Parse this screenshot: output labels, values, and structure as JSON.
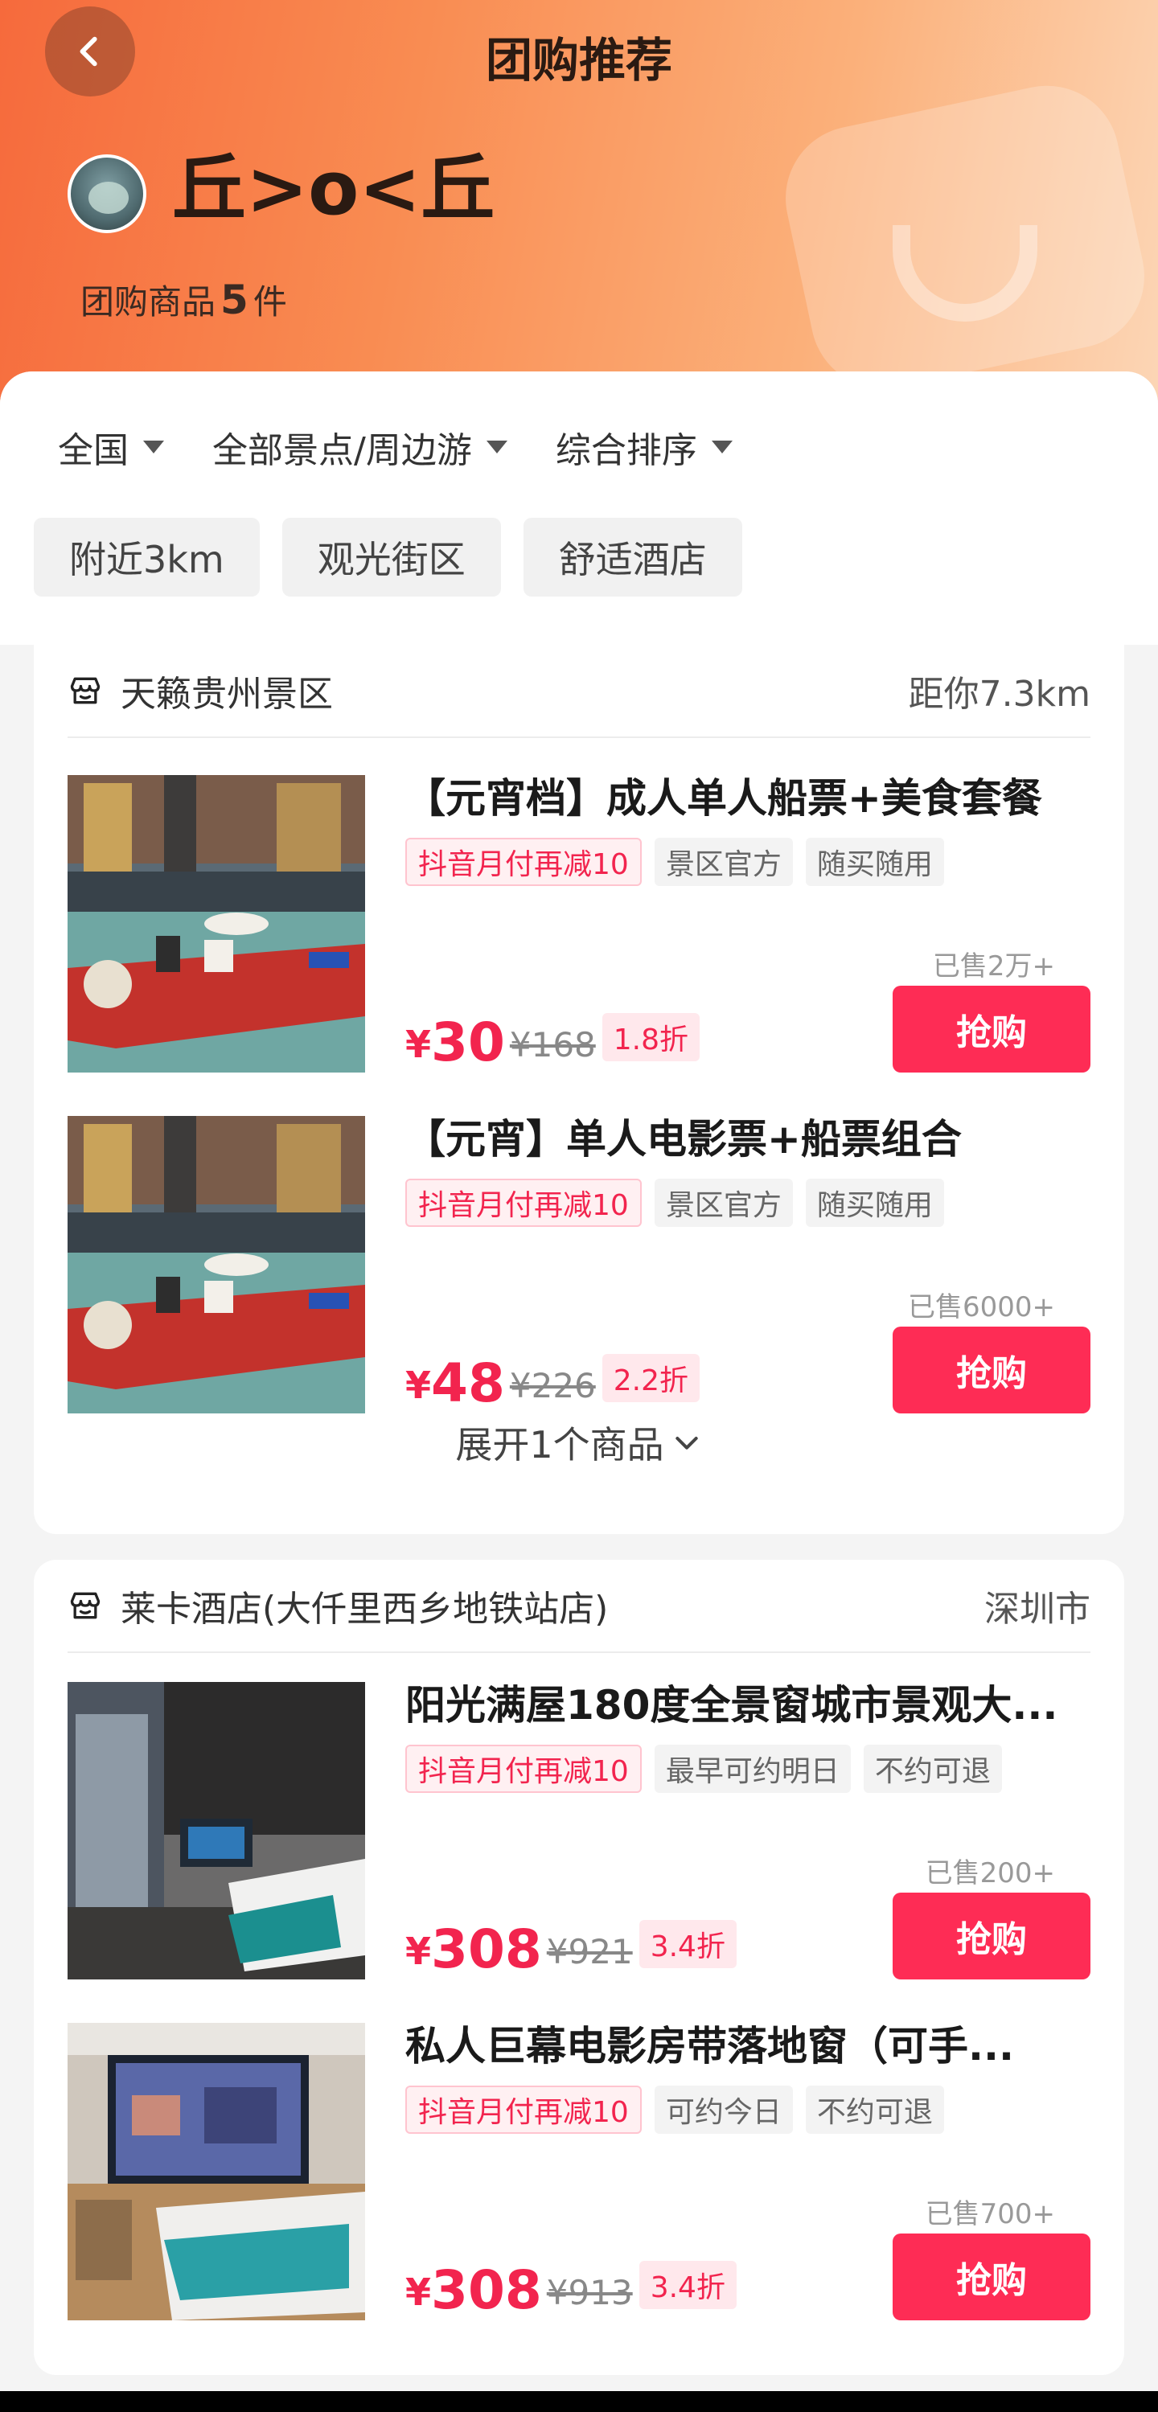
{
  "nav": {
    "title": "团购推荐",
    "back_icon": "chevron-left-icon"
  },
  "shop": {
    "name": "丘>o<丘",
    "count_label": "团购商品",
    "count": "5",
    "count_unit": "件"
  },
  "filters": [
    {
      "label": "全国"
    },
    {
      "label": "全部景点/周边游"
    },
    {
      "label": "综合排序"
    }
  ],
  "chips": [
    "附近3km",
    "观光街区",
    "舒适酒店"
  ],
  "stores": [
    {
      "name": "天籁贵州景区",
      "distance": "距你7.3km",
      "items": [
        {
          "title": "【元宵档】成人单人船票+美食套餐",
          "tags": [
            "抖音月付再减10",
            "景区官方",
            "随买随用"
          ],
          "sold": "已售2万+",
          "yen": "¥",
          "price": "30",
          "original": "¥168",
          "discount": "1.8折",
          "button": "抢购"
        },
        {
          "title": "【元宵】单人电影票+船票组合",
          "tags": [
            "抖音月付再减10",
            "景区官方",
            "随买随用"
          ],
          "sold": "已售6000+",
          "yen": "¥",
          "price": "48",
          "original": "¥226",
          "discount": "2.2折",
          "button": "抢购"
        }
      ],
      "expand": "展开1个商品"
    },
    {
      "name": "莱卡酒店(大仟里西乡地铁站店)",
      "distance": "深圳市",
      "items": [
        {
          "title": "阳光满屋180度全景窗城市景观大...",
          "tags": [
            "抖音月付再减10",
            "最早可约明日",
            "不约可退"
          ],
          "sold": "已售200+",
          "yen": "¥",
          "price": "308",
          "original": "¥921",
          "discount": "3.4折",
          "button": "抢购"
        },
        {
          "title": "私人巨幕电影房带落地窗（可手...",
          "tags": [
            "抖音月付再减10",
            "可约今日",
            "不约可退"
          ],
          "sold": "已售700+",
          "yen": "¥",
          "price": "308",
          "original": "¥913",
          "discount": "3.4折",
          "button": "抢购"
        }
      ]
    }
  ],
  "colors": {
    "accent": "#fe2c55",
    "price": "#f2244e",
    "hero_start": "#f66a3c",
    "hero_end": "#fcd6b6"
  }
}
